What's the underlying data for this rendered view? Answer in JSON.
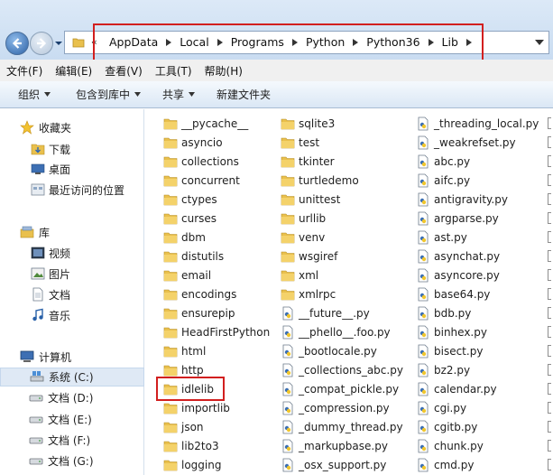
{
  "address_bar": {
    "crumbs": [
      "AppData",
      "Local",
      "Programs",
      "Python",
      "Python36",
      "Lib"
    ]
  },
  "menu": [
    "文件(F)",
    "编辑(E)",
    "查看(V)",
    "工具(T)",
    "帮助(H)"
  ],
  "toolbar": {
    "organize": "组织",
    "include_in_library": "包含到库中",
    "share": "共享",
    "new_folder": "新建文件夹"
  },
  "nav": {
    "favorites": "收藏夹",
    "downloads": "下载",
    "desktop": "桌面",
    "recent": "最近访问的位置",
    "libraries": "库",
    "videos": "视频",
    "pictures": "图片",
    "documents": "文档",
    "music": "音乐",
    "computer": "计算机",
    "drives": [
      "系统 (C:)",
      "文档 (D:)",
      "文档 (E:)",
      "文档 (F:)",
      "文档 (G:)"
    ]
  },
  "files": {
    "col1": [
      "__pycache__",
      "asyncio",
      "collections",
      "concurrent",
      "ctypes",
      "curses",
      "dbm",
      "distutils",
      "email",
      "encodings",
      "ensurepip",
      "HeadFirstPython",
      "html",
      "http",
      "idlelib",
      "importlib",
      "json",
      "lib2to3",
      "logging"
    ],
    "col2": [
      "sqlite3",
      "test",
      "tkinter",
      "turtledemo",
      "unittest",
      "urllib",
      "venv",
      "wsgiref",
      "xml",
      "xmlrpc",
      "__future__.py",
      "__phello__.foo.py",
      "_bootlocale.py",
      "_collections_abc.py",
      "_compat_pickle.py",
      "_compression.py",
      "_dummy_thread.py",
      "_markupbase.py",
      "_osx_support.py"
    ],
    "col3": [
      "_threading_local.py",
      "_weakrefset.py",
      "abc.py",
      "aifc.py",
      "antigravity.py",
      "argparse.py",
      "ast.py",
      "asynchat.py",
      "asyncore.py",
      "base64.py",
      "bdb.py",
      "binhex.py",
      "bisect.py",
      "bz2.py",
      "calendar.py",
      "cgi.py",
      "cgitb.py",
      "chunk.py",
      "cmd.py"
    ]
  },
  "colors": {
    "highlight": "#d21f1f",
    "folder": "#e9c04d"
  }
}
